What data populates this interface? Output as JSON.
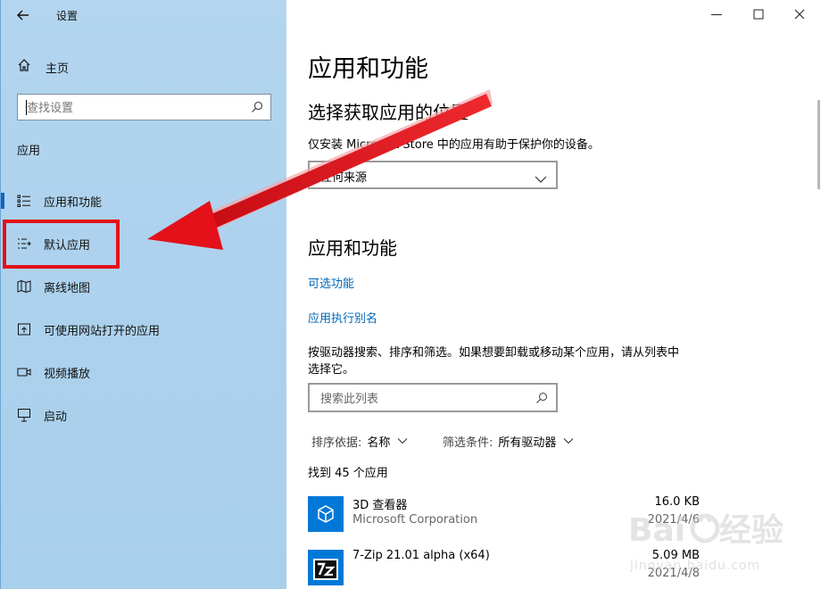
{
  "window": {
    "title": "设置",
    "controls": {
      "minimize_icon": "minimize-icon",
      "maximize_icon": "maximize-icon",
      "close_icon": "close-icon"
    }
  },
  "sidebar": {
    "home_label": "主页",
    "search_placeholder": "查找设置",
    "section_label": "应用",
    "items": [
      {
        "label": "应用和功能",
        "icon": "apps-features-icon",
        "selected": true
      },
      {
        "label": "默认应用",
        "icon": "default-apps-icon",
        "selected": false
      },
      {
        "label": "离线地图",
        "icon": "offline-maps-icon",
        "selected": false
      },
      {
        "label": "可使用网站打开的应用",
        "icon": "apps-for-websites-icon",
        "selected": false
      },
      {
        "label": "视频播放",
        "icon": "video-playback-icon",
        "selected": false
      },
      {
        "label": "启动",
        "icon": "startup-icon",
        "selected": false
      }
    ]
  },
  "main": {
    "page_title": "应用和功能",
    "choose_section": {
      "heading": "选择获取应用的位置",
      "description": "仅安装 Microsoft Store 中的应用有助于保护你的设备。",
      "dropdown_value": "任何来源"
    },
    "apps_section": {
      "heading": "应用和功能",
      "link_optional": "可选功能",
      "link_aliases": "应用执行别名",
      "description_line1": "按驱动器搜索、排序和筛选。如果想要卸载或移动某个应用，请从列表中",
      "description_line2": "选择它。",
      "search_placeholder": "搜索此列表",
      "sort_label": "排序依据:",
      "sort_value": "名称",
      "filter_label": "筛选条件:",
      "filter_value": "所有驱动器",
      "count_text": "找到 45 个应用"
    },
    "apps": [
      {
        "name": "3D 查看器",
        "publisher": "Microsoft Corporation",
        "size": "16.0 KB",
        "date": "2021/4/6",
        "icon": "3d-viewer-icon"
      },
      {
        "name": "7-Zip 21.01 alpha (x64)",
        "publisher": "",
        "size": "5.09 MB",
        "date": "2021/4/8",
        "icon": "7zip-icon"
      }
    ]
  },
  "watermark": {
    "text": "jingyan.baidu.com"
  },
  "colors": {
    "accent": "#0067b8",
    "sidebar_bg": "#afd3ee",
    "annotation_red": "#e4101a",
    "app_tile": "#0078d7"
  }
}
